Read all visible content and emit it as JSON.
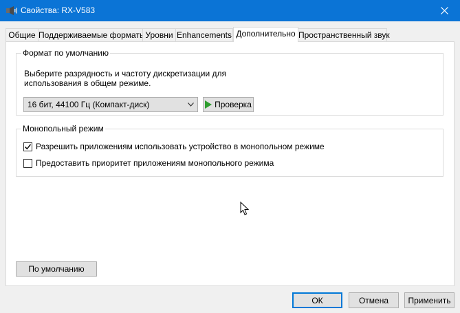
{
  "window": {
    "title": "Свойства: RX-V583",
    "icon": "speaker-icon",
    "close_icon": "close-icon",
    "titlebar_color": "#0b74d6"
  },
  "tabs": [
    {
      "label": "Общие"
    },
    {
      "label": "Поддерживаемые форматы"
    },
    {
      "label": "Уровни"
    },
    {
      "label": "Enhancements"
    },
    {
      "label": "Дополнительно",
      "active": true
    },
    {
      "label": "Пространственный звук"
    }
  ],
  "default_format": {
    "group_title": "Формат по умолчанию",
    "description": "Выберите разрядность и частоту дискретизации для использования в общем режиме.",
    "selected_format": "16 бит, 44100 Гц (Компакт-диск)",
    "test_button": "Проверка",
    "test_icon_color": "#2e9d2e"
  },
  "exclusive_mode": {
    "group_title": "Монопольный режим",
    "options": [
      {
        "label": "Разрешить приложениям использовать устройство в монопольном режиме",
        "checked": true
      },
      {
        "label": "Предоставить приоритет приложениям монопольного режима",
        "checked": false
      }
    ]
  },
  "buttons": {
    "restore_default": "По умолчанию",
    "ok": "ОК",
    "cancel": "Отмена",
    "apply": "Применить"
  },
  "accent_color": "#0078d7"
}
